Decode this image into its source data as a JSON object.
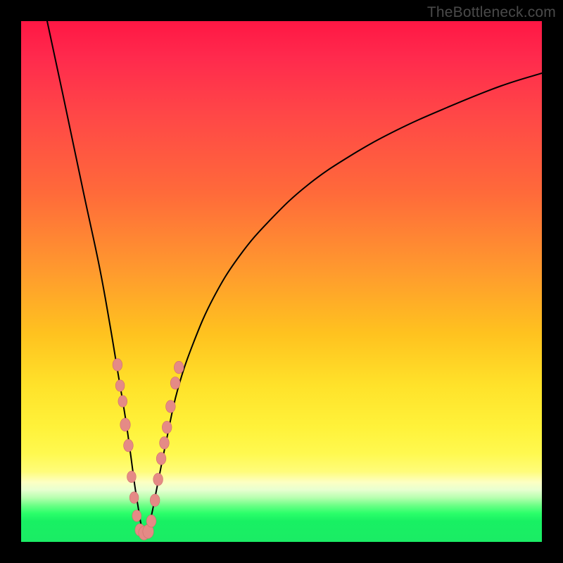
{
  "watermark": "TheBottleneck.com",
  "colors": {
    "curve_stroke": "#000000",
    "curve_width": 2.0,
    "marker_fill": "#e58a86",
    "marker_stroke": "#cf6f6c"
  },
  "chart_data": {
    "type": "line",
    "title": "",
    "xlabel": "",
    "ylabel": "",
    "xlim": [
      0,
      100
    ],
    "ylim": [
      0,
      100
    ],
    "series": [
      {
        "name": "bottleneck-curve",
        "x": [
          5,
          8,
          12,
          15,
          17,
          18.5,
          20,
          21,
          21.8,
          22.5,
          23,
          23.5,
          24,
          25,
          26,
          28,
          30,
          33,
          37,
          42,
          48,
          55,
          63,
          72,
          82,
          92,
          100
        ],
        "y": [
          100,
          86,
          67,
          53,
          42,
          33,
          24,
          17,
          11,
          6.5,
          3.5,
          1.5,
          1.8,
          5,
          10,
          20,
          29,
          38,
          47,
          55,
          62,
          68.5,
          74,
          79,
          83.5,
          87.5,
          90
        ]
      }
    ],
    "markers": {
      "name": "datapoints",
      "points": [
        {
          "x": 18.5,
          "y": 34,
          "r": 1.6
        },
        {
          "x": 19.0,
          "y": 30,
          "r": 1.5
        },
        {
          "x": 19.5,
          "y": 27,
          "r": 1.5
        },
        {
          "x": 20.0,
          "y": 22.5,
          "r": 1.7
        },
        {
          "x": 20.6,
          "y": 18.5,
          "r": 1.6
        },
        {
          "x": 21.2,
          "y": 12.5,
          "r": 1.5
        },
        {
          "x": 21.7,
          "y": 8.5,
          "r": 1.5
        },
        {
          "x": 22.2,
          "y": 5.0,
          "r": 1.5
        },
        {
          "x": 22.8,
          "y": 2.3,
          "r": 1.6
        },
        {
          "x": 23.6,
          "y": 1.7,
          "r": 1.8
        },
        {
          "x": 24.4,
          "y": 2.0,
          "r": 1.8
        },
        {
          "x": 25.0,
          "y": 4.0,
          "r": 1.6
        },
        {
          "x": 25.7,
          "y": 8.0,
          "r": 1.6
        },
        {
          "x": 26.3,
          "y": 12.0,
          "r": 1.6
        },
        {
          "x": 26.9,
          "y": 16.0,
          "r": 1.6
        },
        {
          "x": 27.5,
          "y": 19.0,
          "r": 1.6
        },
        {
          "x": 28.0,
          "y": 22.0,
          "r": 1.6
        },
        {
          "x": 28.7,
          "y": 26.0,
          "r": 1.6
        },
        {
          "x": 29.6,
          "y": 30.5,
          "r": 1.6
        },
        {
          "x": 30.3,
          "y": 33.5,
          "r": 1.6
        }
      ]
    }
  }
}
